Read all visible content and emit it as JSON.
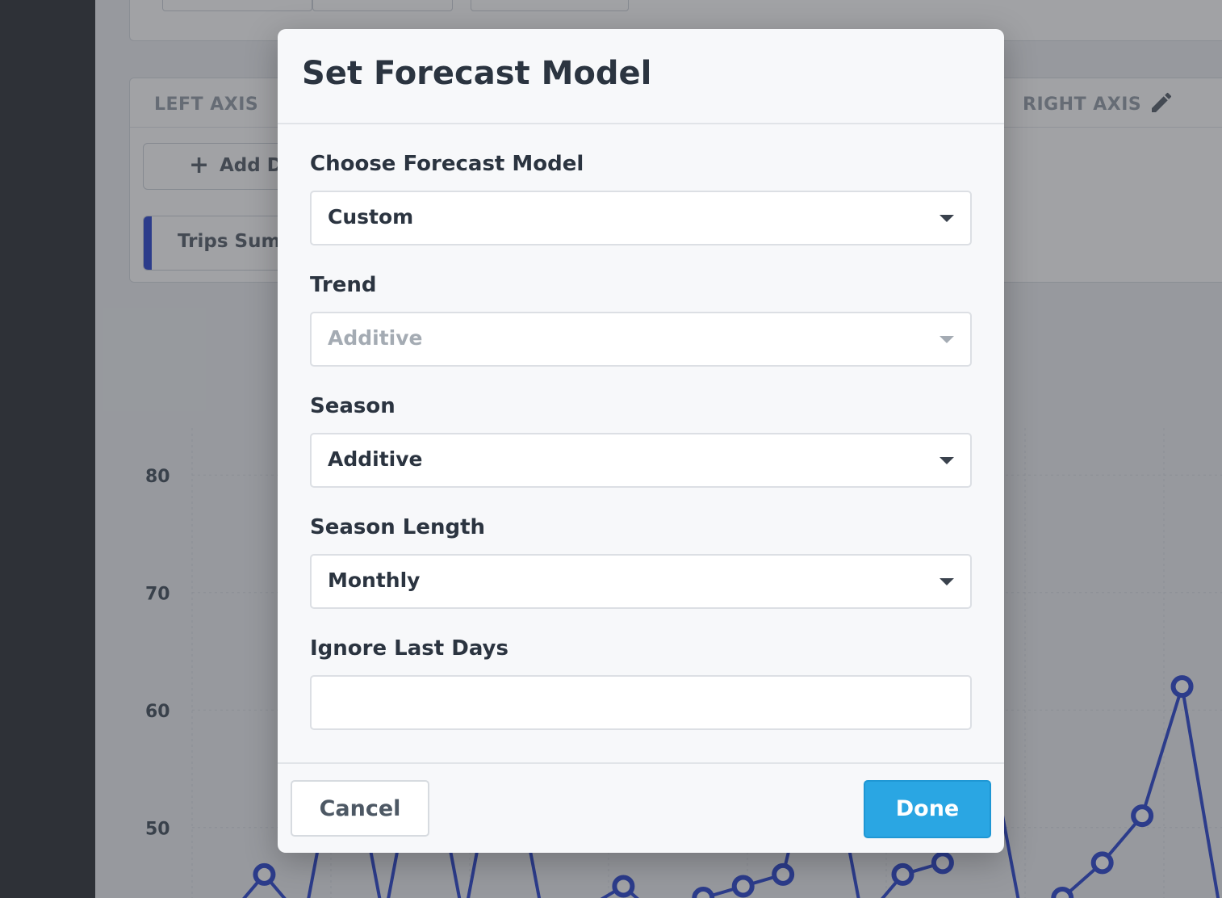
{
  "background": {
    "axis_panel": {
      "left_axis_label": "LEFT AXIS",
      "right_axis_label": "RIGHT AXIS",
      "edit_icon": "pencil-icon",
      "add_data_label": "Add D",
      "add_icon": "plus-icon",
      "series_chip_label": "Trips Sum",
      "series_color": "#3650d3"
    }
  },
  "chart_data": {
    "type": "line",
    "y_ticks": [
      "80",
      "70",
      "60",
      "50"
    ],
    "ylim": [
      44,
      84
    ],
    "grid": true,
    "series": [
      {
        "color": "#3650d3",
        "points": [
          [
            0,
            42
          ],
          [
            1,
            46
          ],
          [
            2,
            42
          ],
          [
            3,
            60
          ],
          [
            4,
            42
          ],
          [
            5,
            60
          ],
          [
            6,
            42
          ],
          [
            7,
            60
          ],
          [
            8,
            42
          ],
          [
            9,
            43
          ],
          [
            10,
            45
          ],
          [
            11,
            42
          ],
          [
            12,
            44
          ],
          [
            13,
            45
          ],
          [
            14,
            46
          ],
          [
            15,
            60
          ],
          [
            16,
            42
          ],
          [
            17,
            46
          ],
          [
            18,
            47
          ],
          [
            19,
            60
          ],
          [
            20,
            42
          ],
          [
            21,
            44
          ],
          [
            22,
            47
          ],
          [
            23,
            51
          ],
          [
            24,
            62
          ],
          [
            25,
            42
          ]
        ]
      }
    ]
  },
  "modal": {
    "title": "Set Forecast Model",
    "fields": {
      "model": {
        "label": "Choose Forecast Model",
        "value": "Custom"
      },
      "trend": {
        "label": "Trend",
        "value": "Additive",
        "disabled": true
      },
      "season": {
        "label": "Season",
        "value": "Additive"
      },
      "season_length": {
        "label": "Season Length",
        "value": "Monthly"
      },
      "ignore_last_days": {
        "label": "Ignore Last Days",
        "value": "",
        "placeholder": ""
      }
    },
    "footer": {
      "cancel_label": "Cancel",
      "done_label": "Done"
    },
    "colors": {
      "primary": "#2aa6e3",
      "title_text": "#2b3440",
      "disabled_text": "#a4abb3"
    }
  }
}
